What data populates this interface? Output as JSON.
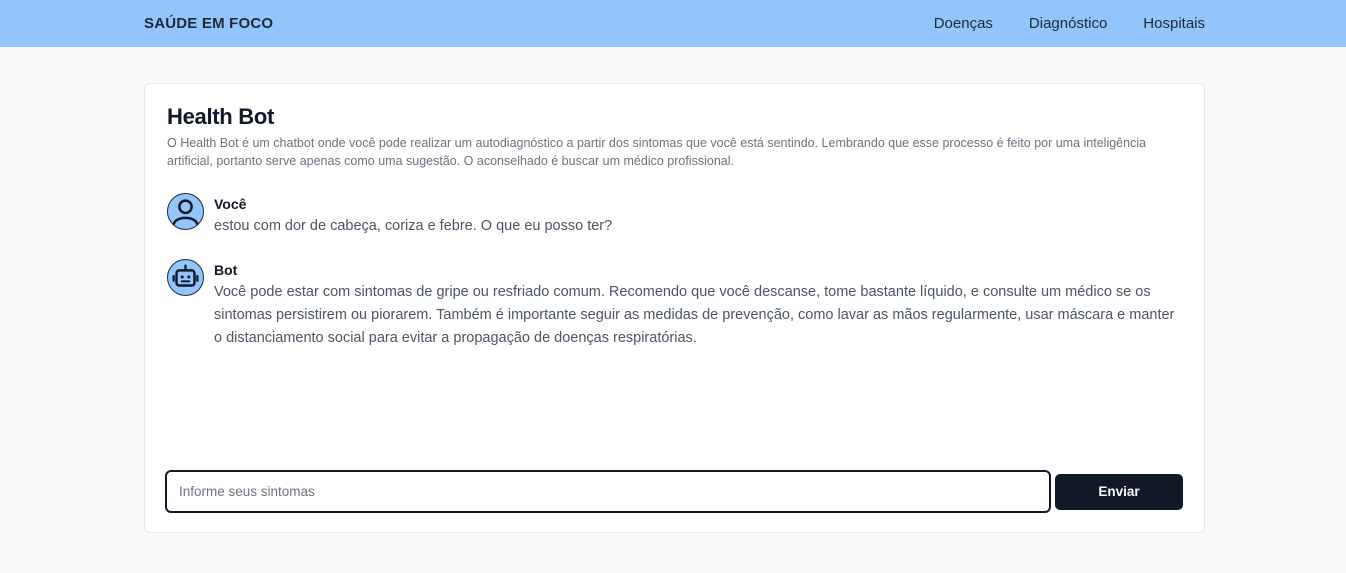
{
  "navbar": {
    "brand": "SAÚDE EM FOCO",
    "links": [
      "Doenças",
      "Diagnóstico",
      "Hospitais"
    ]
  },
  "chat": {
    "title": "Health Bot",
    "description": "O Health Bot é um chatbot onde você pode realizar um autodiagnóstico a partir dos sintomas que você está sentindo. Lembrando que esse processo é feito por uma inteligência artificial, portanto serve apenas como uma sugestão. O aconselhado é buscar um médico profissional.",
    "messages": [
      {
        "sender": "Você",
        "avatar_icon": "user-icon",
        "text": "estou com dor de cabeça, coriza e febre. O que eu posso ter?"
      },
      {
        "sender": "Bot",
        "avatar_icon": "robot-icon",
        "text": "Você pode estar com sintomas de gripe ou resfriado comum. Recomendo que você descanse, tome bastante líquido, e consulte um médico se os sintomas persistirem ou piorarem. Também é importante seguir as medidas de prevenção, como lavar as mãos regularmente, usar máscara e manter o distanciamento social para evitar a propagação de doenças respiratórias."
      }
    ],
    "input": {
      "placeholder": "Informe seus sintomas",
      "value": ""
    },
    "send_label": "Enviar"
  },
  "colors": {
    "navbar_bg": "#93c5fd",
    "avatar_bg": "#93c5fd",
    "button_bg": "#111827",
    "page_bg": "#f9fafb"
  }
}
